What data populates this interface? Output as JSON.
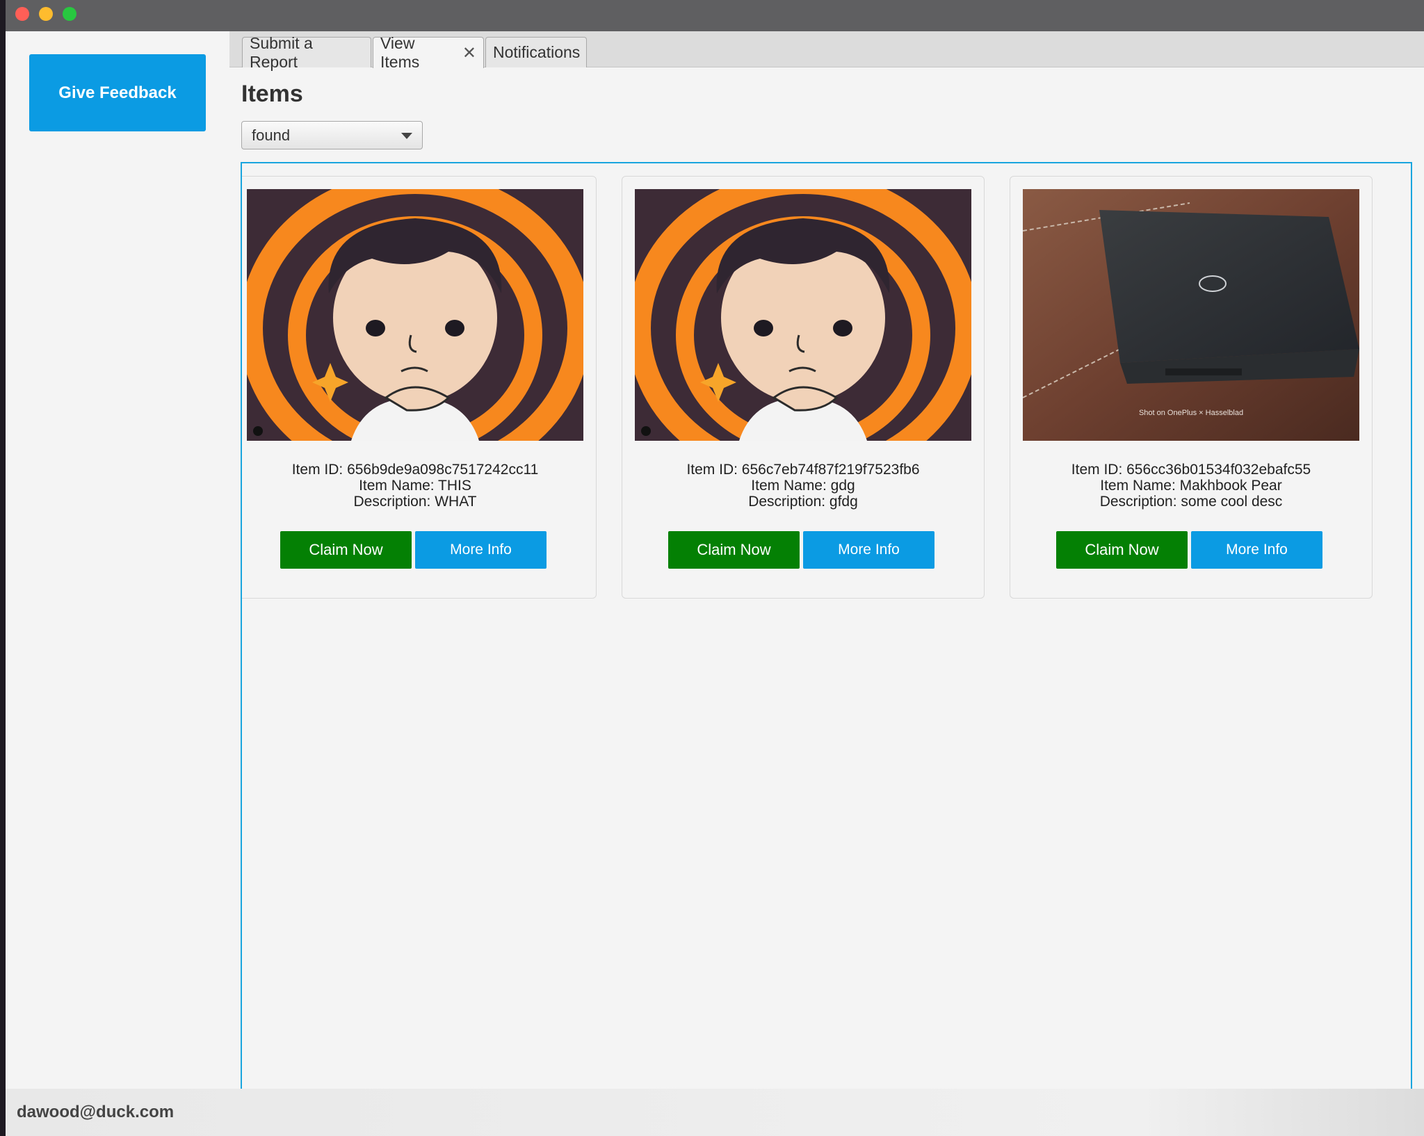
{
  "sidebar": {
    "feedback_label": "Give Feedback"
  },
  "tabs": [
    {
      "label": "Submit a Report"
    },
    {
      "label": "View Items",
      "close_glyph": "✕"
    },
    {
      "label": "Notifications"
    }
  ],
  "main": {
    "title": "Items",
    "filter": {
      "selected": "found"
    }
  },
  "cards": [
    {
      "id_line": "Item ID: 656b9de9a098c7517242cc11",
      "name_line": "Item Name: THIS",
      "desc_line": "Description: WHAT",
      "image": "avatar-illustration",
      "claim_label": "Claim Now",
      "info_label": "More Info"
    },
    {
      "id_line": "Item ID: 656c7eb74f87f219f7523fb6",
      "name_line": "Item Name: gdg",
      "desc_line": "Description: gfdg",
      "image": "avatar-illustration",
      "claim_label": "Claim Now",
      "info_label": "More Info"
    },
    {
      "id_line": "Item ID: 656cc36b01534f032ebafc55",
      "name_line": "Item Name: Makhbook Pear",
      "desc_line": "Description: some cool desc",
      "image": "laptop-photo",
      "photo_caption": "Shot on OnePlus × Hasselblad",
      "claim_label": "Claim Now",
      "info_label": "More Info"
    }
  ],
  "status": {
    "email": "dawood@duck.com"
  },
  "colors": {
    "accent_blue": "#0b9be3",
    "claim_green": "#048004",
    "scroll_border": "#19a5de"
  }
}
